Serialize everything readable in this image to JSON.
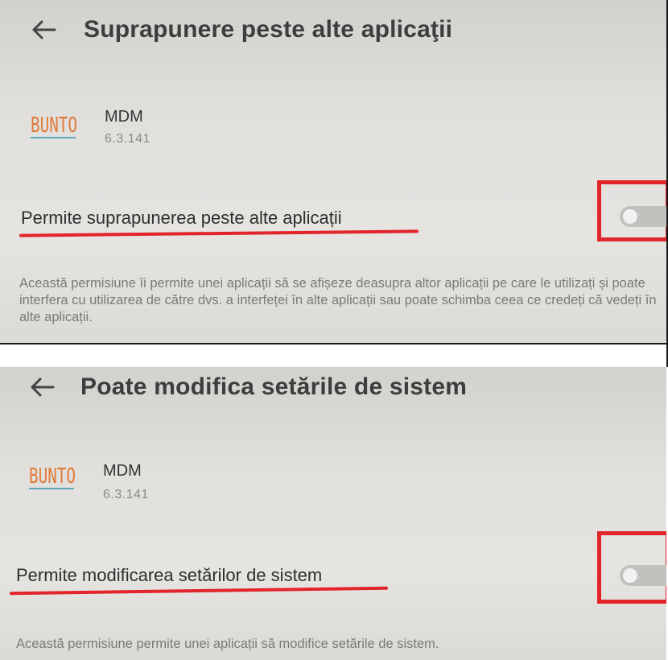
{
  "panel_1": {
    "title": "Suprapunere peste alte aplicaţii",
    "app": {
      "name": "MDM",
      "version": "6.3.141",
      "logo_icon": "bunto-logo-icon"
    },
    "permission_label": "Permite suprapunerea peste alte aplicații",
    "toggle_state": "off",
    "description": "Această permisiune îi permite unei aplicații să se afișeze deasupra altor aplicații pe care le utilizați și poate interfera cu utilizarea de către dvs. a interfeței în alte aplicații sau poate schimba ceea ce credeți că vedeți în alte aplicații."
  },
  "panel_2": {
    "title": "Poate modifica setările de sistem",
    "app": {
      "name": "MDM",
      "version": "6.3.141",
      "logo_icon": "bunto-logo-icon"
    },
    "permission_label": "Permite modificarea setărilor de sistem",
    "toggle_state": "off",
    "description": "Această permisiune permite unei aplicații să modifice setările de sistem."
  },
  "colors": {
    "annotation_red": "#e2242b",
    "screen_background": "#e3e1de",
    "toggle_off_track": "#c3c1be",
    "logo_orange": "#e07a3a",
    "logo_teal": "#5aa8b8"
  }
}
